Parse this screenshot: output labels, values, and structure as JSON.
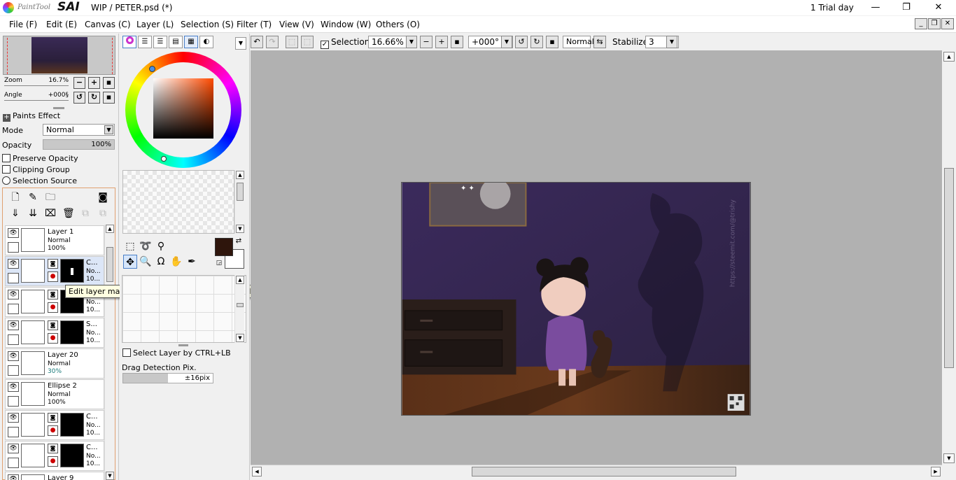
{
  "app": {
    "logo_text": "PaintTool SAI",
    "doc_title": "WIP / PETER.psd (*)",
    "trial": "1 Trial day",
    "window_buttons": [
      "—",
      "❐",
      "✕"
    ]
  },
  "menu": [
    "File (F)",
    "Edit (E)",
    "Canvas (C)",
    "Layer (L)",
    "Selection (S)",
    "Filter (T)",
    "View (V)",
    "Window (W)",
    "Others (O)"
  ],
  "navigator": {
    "zoom_label": "Zoom",
    "zoom_value": "16.7%",
    "angle_label": "Angle",
    "angle_value": "+000§"
  },
  "paint_effect": {
    "header": "Paints Effect",
    "mode_label": "Mode",
    "mode_value": "Normal",
    "opacity_label": "Opacity",
    "opacity_value": "100%",
    "preserve_opacity": "Preserve Opacity",
    "clipping_group": "Clipping Group",
    "selection_source": "Selection Source"
  },
  "layers": [
    {
      "name": "Layer 1",
      "mode": "Normal",
      "opacity": "100%",
      "mask": false,
      "selected": false
    },
    {
      "name": "C...",
      "mode": "No...",
      "opacity": "10...",
      "mask": true,
      "selected": true
    },
    {
      "name": "",
      "mode": "No...",
      "opacity": "10...",
      "mask": true,
      "selected": false
    },
    {
      "name": "S...",
      "mode": "No...",
      "opacity": "10...",
      "mask": true,
      "selected": false
    },
    {
      "name": "Layer 20",
      "mode": "Normal",
      "opacity": "30%",
      "mask": false,
      "selected": false
    },
    {
      "name": "Ellipse 2",
      "mode": "Normal",
      "opacity": "100%",
      "mask": false,
      "selected": false
    },
    {
      "name": "C...",
      "mode": "No...",
      "opacity": "10...",
      "mask": true,
      "selected": false
    },
    {
      "name": "C...",
      "mode": "No...",
      "opacity": "10...",
      "mask": true,
      "selected": false
    },
    {
      "name": "Layer 9",
      "mode": "",
      "opacity": "",
      "mask": false,
      "selected": false
    }
  ],
  "tooltip": "Edit layer mask (to quit editing, click thumbnail or near the name of layer)",
  "color": {
    "foreground": "#2e150c",
    "background": "#ffffff"
  },
  "tool_options": {
    "select_layer": "Select Layer by CTRL+LB",
    "drag_detection_label": "Drag Detection Pix.",
    "drag_detection_value": "±16pix"
  },
  "toolbar": {
    "selection_label": "Selection",
    "zoom": "16.66%",
    "rotation": "+000°",
    "blend": "Normal",
    "stabilizer_label": "Stabilizer",
    "stabilizer_value": "3"
  },
  "artwork": {
    "watermark": "https://steemit.com/@trishy"
  }
}
